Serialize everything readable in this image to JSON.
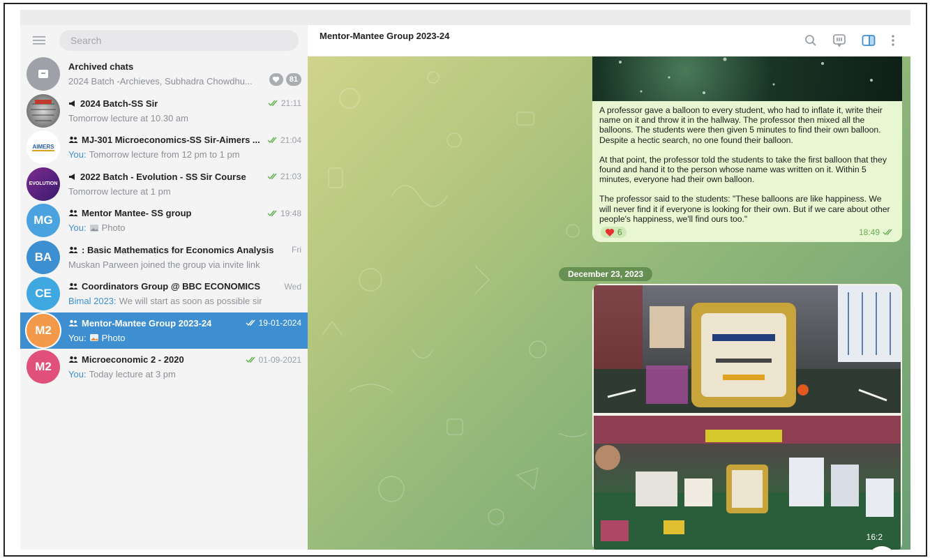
{
  "sidebar": {
    "search_placeholder": "Search",
    "chats": [
      {
        "title": "Archived chats",
        "preview": "2024 Batch -Archieves, Subhadra Chowdhu...",
        "badge": "81",
        "avatar_color": "#9ea2a8"
      },
      {
        "title": "2024 Batch-SS Sir",
        "time": "21:11",
        "preview": "Tomorrow lecture at 10.30 am",
        "icon": "megaphone-icon"
      },
      {
        "title": "MJ-301 Microeconomics-SS Sir-Aimers ...",
        "time": "21:04",
        "you": "You:",
        "preview": "Tomorrow lecture from 12 pm to 1 pm",
        "icon": "group-icon",
        "avatar_text": "AIMERS"
      },
      {
        "title": "2022 Batch - Evolution - SS Sir Course",
        "time": "21:03",
        "preview": "Tomorrow lecture at 1 pm",
        "icon": "megaphone-icon",
        "avatar_text": "EVOLUTION"
      },
      {
        "title": "Mentor Mantee- SS group",
        "time": "19:48",
        "you": "You:",
        "preview": "Photo",
        "icon": "group-icon",
        "initials": "MG",
        "avatar_color": "#4aa3de"
      },
      {
        "title": ": Basic Mathematics for Economics Analysis",
        "time": "Fri",
        "preview": "Muskan Parween joined the group via invite link",
        "icon": "group-icon",
        "initials": "BA",
        "avatar_color": "#3c8fd0"
      },
      {
        "title": "Coordinators Group @ BBC ECONOMICS",
        "time": "Wed",
        "you": "Bimal 2023:",
        "preview": "We will start as soon as possible sir",
        "icon": "group-icon",
        "initials": "CE",
        "avatar_color": "#3fa8e0"
      },
      {
        "title": "Mentor-Mantee Group 2023-24",
        "time": "19-01-2024",
        "you": "You:",
        "preview": "Photo",
        "icon": "group-icon",
        "initials": "M2",
        "avatar_color": "#f29a4a"
      },
      {
        "title": "Microeconomic 2 - 2020",
        "time": "01-09-2021",
        "you": "You:",
        "preview": "Today lecture at 3 pm",
        "icon": "group-icon",
        "initials": "M2",
        "avatar_color": "#e0507a"
      }
    ]
  },
  "main": {
    "title": "Mentor-Mantee Group 2023-24",
    "message": {
      "paragraphs": [
        "A professor gave a balloon to every student, who had to inflate it, write their name on it and throw it in the hallway. The professor then mixed all the balloons. The students were then given 5 minutes to find their own balloon.  Despite a hectic search, no one found their balloon.",
        "At that point, the professor told the students to take the first balloon that they found and hand it to the person whose name was written on it. Within 5 minutes, everyone had their own balloon.",
        "The professor said to the students: \"These balloons are like happiness. We will never find it if everyone is looking for their own. But if we care about other people's happiness, we'll find ours too.\""
      ],
      "reaction_count": "6",
      "time": "18:49"
    },
    "date_separator": "December 23, 2023",
    "photo_time": "16:2"
  },
  "colors": {
    "accent": "#3d8fd1",
    "bubble": "#e8f7d2"
  }
}
